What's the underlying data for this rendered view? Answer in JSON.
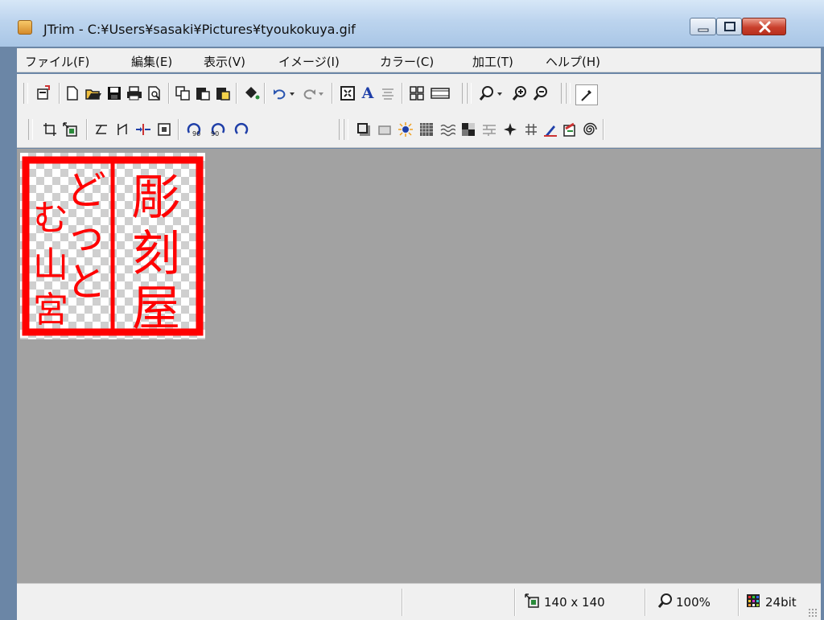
{
  "window": {
    "title": "JTrim - C:¥Users¥sasaki¥Pictures¥tyoukokuya.gif"
  },
  "menu": [
    {
      "label": "ファイル(F)"
    },
    {
      "label": "編集(E)"
    },
    {
      "label": "表示(V)"
    },
    {
      "label": "イメージ(I)"
    },
    {
      "label": "カラー(C)"
    },
    {
      "label": "加工(T)"
    },
    {
      "label": "ヘルプ(H)"
    }
  ],
  "toolbar1": {
    "text_tool_glyph": "A"
  },
  "status": {
    "dimensions": "140 x 140",
    "zoom": "100%",
    "color_depth": "24bit"
  },
  "image": {
    "stamp_text": "彫刻屋どっとむ",
    "stamp_color": "#ff0000"
  },
  "colors": {
    "canvas_bg": "#a2a2a2",
    "chrome_bg": "#f0f0f0",
    "title_bar": "#bcd4ee",
    "close_button": "#c9402d"
  },
  "icons": [
    "app-icon",
    "minimize-icon",
    "maximize-icon",
    "close-icon",
    "import-icon",
    "new-file-icon",
    "open-folder-icon",
    "save-icon",
    "print-icon",
    "print-preview-icon",
    "copy-icon",
    "paste-icon",
    "paste-new-icon",
    "paint-bucket-icon",
    "undo-icon",
    "redo-icon",
    "fit-window-icon",
    "text-tool-icon",
    "align-icon",
    "grid-icon",
    "filmstrip-icon",
    "zoom-menu-icon",
    "zoom-in-icon",
    "zoom-out-icon",
    "eyedropper-icon",
    "crop-icon",
    "resize-icon",
    "flip-horizontal-icon",
    "flip-vertical-icon",
    "trim-icon",
    "frame-icon",
    "rotate-left-90-icon",
    "rotate-right-90-icon",
    "rotate-free-icon",
    "shadow-icon",
    "emboss-icon",
    "sunburst-icon",
    "mosaic-icon",
    "wave-icon",
    "pattern-icon",
    "brick-icon",
    "starburst-icon",
    "lattice-icon",
    "pen-icon",
    "erase-paint-icon",
    "spiral-icon",
    "size-icon",
    "zoom-status-icon",
    "color-depth-icon"
  ]
}
